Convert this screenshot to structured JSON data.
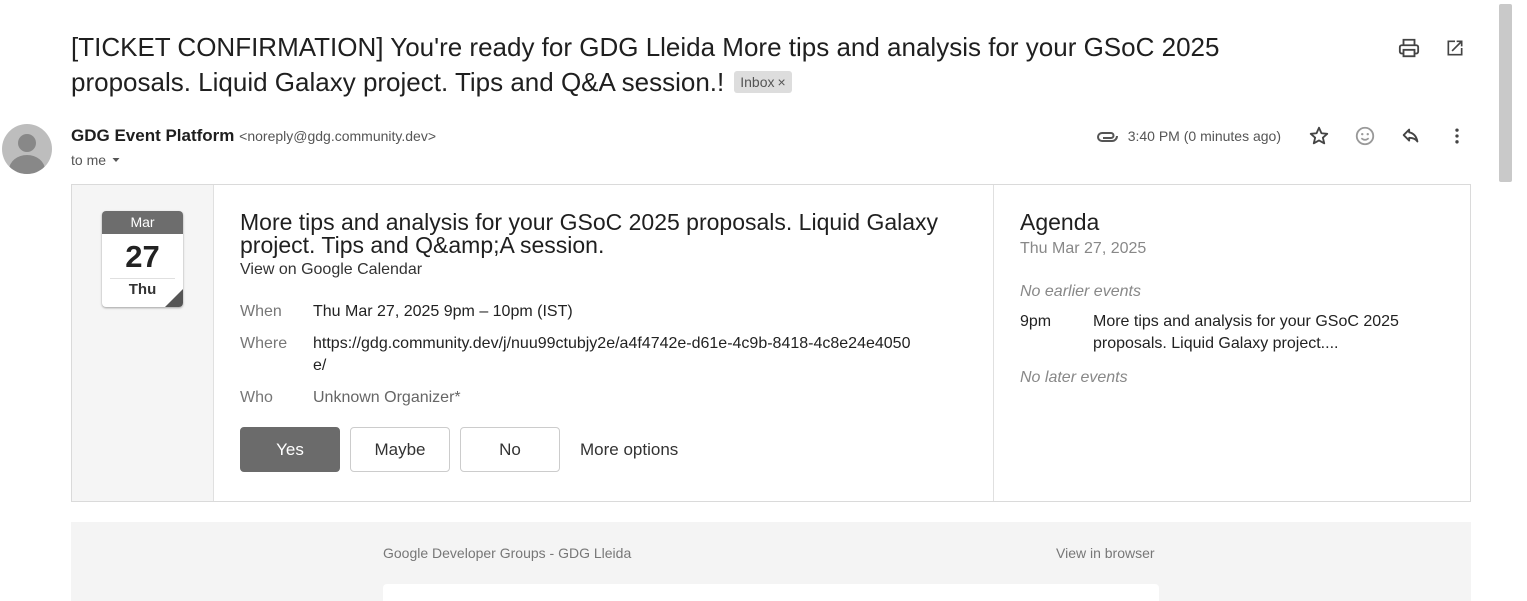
{
  "subject": {
    "text": "[TICKET CONFIRMATION] You're ready for GDG Lleida More tips and analysis for your GSoC 2025 proposals. Liquid Galaxy project. Tips and Q&A session.!",
    "label_chip": "Inbox",
    "label_chip_close": "×"
  },
  "sender": {
    "name": "GDG Event Platform",
    "email": "<noreply@gdg.community.dev>",
    "to": "to me",
    "time": "3:40 PM (0 minutes ago)"
  },
  "calendar_icon": {
    "month": "Mar",
    "day": "27",
    "weekday": "Thu"
  },
  "event": {
    "title": "More tips and analysis for your GSoC 2025 proposals. Liquid Galaxy project. Tips and Q&amp;A session.",
    "view_link": "View on Google Calendar",
    "when_label": "When",
    "when_value": "Thu Mar 27, 2025 9pm – 10pm (IST)",
    "where_label": "Where",
    "where_value": "https://gdg.community.dev/j/nuu99ctubjy2e/a4f4742e-d61e-4c9b-8418-4c8e24e4050e/",
    "who_label": "Who",
    "who_value": "Unknown Organizer*"
  },
  "rsvp": {
    "yes": "Yes",
    "maybe": "Maybe",
    "no": "No",
    "more": "More options"
  },
  "agenda": {
    "title": "Agenda",
    "date": "Thu Mar 27, 2025",
    "no_earlier": "No earlier events",
    "event_time": "9pm",
    "event_desc": "More tips and analysis for your GSoC 2025 proposals. Liquid Galaxy project....",
    "no_later": "No later events"
  },
  "footer": {
    "left": "Google Developer Groups - GDG Lleida",
    "right": "View in browser"
  },
  "icons": [
    "print-icon",
    "open-new-window-icon",
    "paperclip-icon",
    "star-icon",
    "emoji-icon",
    "reply-icon",
    "more-vert-icon",
    "dropdown-icon"
  ]
}
